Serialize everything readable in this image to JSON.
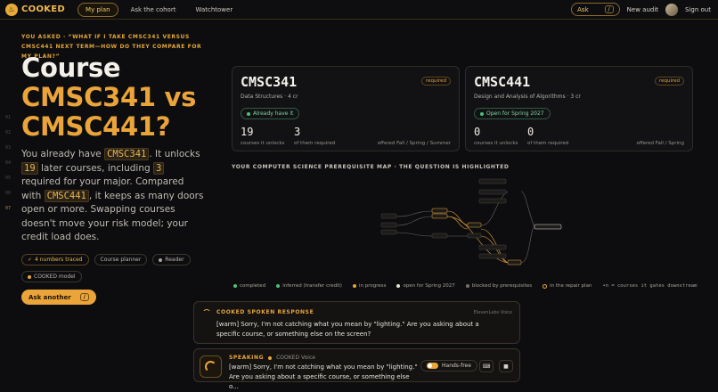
{
  "app": {
    "name": "COOKED"
  },
  "nav": [
    {
      "label": "My plan",
      "active": true
    },
    {
      "label": "Ask the cohort"
    },
    {
      "label": "Watchtower"
    }
  ],
  "top_right": {
    "ask_label": "Ask",
    "ask_kbd": "/",
    "new_audit": "New audit",
    "sign_out": "Sign out"
  },
  "hero": {
    "eyebrow": "YOU ASKED · “WHAT IF I TAKE CMSC341 VERSUS CMSC441 NEXT TERM—HOW DO THEY COMPARE FOR MY PLAN?”",
    "line1": "Course",
    "line2": "CMSC341 vs",
    "line3": "CMSC441?",
    "line_numbers": [
      "01",
      "02",
      "03",
      "04",
      "05",
      "06",
      "07"
    ],
    "para": {
      "p1": "You already have ",
      "c1": "CMSC341",
      "p2": ". It unlocks ",
      "n1": "19",
      "p3": " later courses, including ",
      "n2": "3",
      "p4": " required for your major. Compared with ",
      "c2": "CMSC441",
      "p5": ", it keeps as many doors open or more. Swapping courses doesn't move your risk model; your credit load does."
    },
    "chips": [
      "4 numbers traced",
      "Course planner",
      "Reader",
      "COOKED model"
    ],
    "ask_another": "Ask another",
    "ask_another_kbd": "/"
  },
  "cards": [
    {
      "code": "CMSC341",
      "sub": "Data Structures · 4 cr",
      "badge": "required",
      "status": "Already have it",
      "n1": "19",
      "l1": "courses it unlocks",
      "n2": "3",
      "l2": "of them required",
      "offered": "offered Fall / Spring / Summer"
    },
    {
      "code": "CMSC441",
      "sub": "Design and Analysis of Algorithms · 3 cr",
      "badge": "required",
      "status": "Open for Spring 2027",
      "n1": "0",
      "l1": "courses it unlocks",
      "n2": "0",
      "l2": "of them required",
      "offered": "offered Fall / Spring"
    }
  ],
  "map": {
    "title": "YOUR COMPUTER SCIENCE PREREQUISITE MAP · THE QUESTION IS HIGHLIGHTED",
    "legend": [
      {
        "label": "completed",
        "color": "#4fbf7a"
      },
      {
        "label": "inferred (transfer credit)",
        "color": "#4fbf7a"
      },
      {
        "label": "in progress",
        "color": "#e9a63b"
      },
      {
        "label": "open for Spring 2027",
        "color": "#e8e4dc"
      },
      {
        "label": "blocked by prerequisites",
        "color": "#77716a"
      },
      {
        "label": "in the repair plan",
        "color": "#e9a63b"
      },
      {
        "label": "•n = courses it gates downstream",
        "color": ""
      }
    ]
  },
  "voice": {
    "heading": "COOKED SPOKEN RESPONSE",
    "source": "ElevenLabs Voice",
    "text": "[warm] Sorry, I'm not catching what you mean by \"lighting.\" Are you asking about a specific course, or something else on the screen?"
  },
  "speaking": {
    "label": "SPEAKING",
    "voice": "COOKED Voice",
    "text": "[warm] Sorry, I'm not catching what you mean by \"lighting.\" Are you asking about a specific course, or something else o...",
    "hands_free": "Hands-free"
  }
}
